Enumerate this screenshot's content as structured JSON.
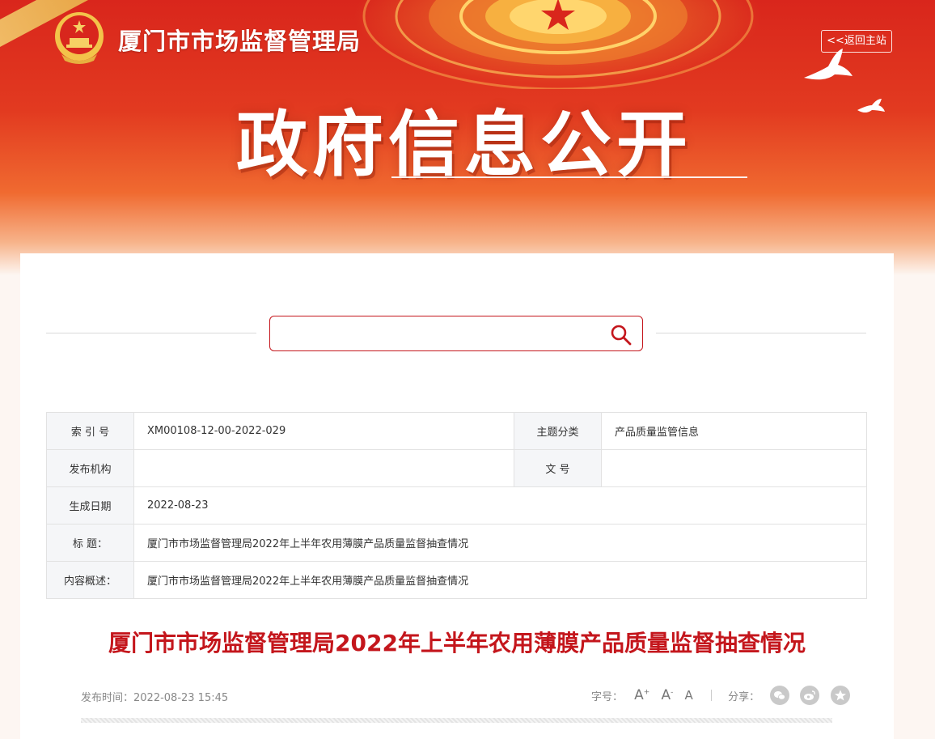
{
  "header": {
    "site_title": "厦门市市场监督管理局",
    "banner_title": "政府信息公开",
    "back_link": "<<返回主站"
  },
  "search": {
    "placeholder": ""
  },
  "meta": {
    "index_no_label": "索 引 号",
    "index_no": "XM00108-12-00-2022-029",
    "topic_label": "主题分类",
    "topic": "产品质量监管信息",
    "publisher_label": "发布机构",
    "publisher": "",
    "doc_no_label": "文  号",
    "doc_no": "",
    "date_label": "生成日期",
    "date": "2022-08-23",
    "title_label": "标  题：",
    "title": "厦门市市场监督管理局2022年上半年农用薄膜产品质量监督抽查情况",
    "summary_label": "内容概述：",
    "summary": "厦门市市场监督管理局2022年上半年农用薄膜产品质量监督抽查情况"
  },
  "article": {
    "title": "厦门市市场监督管理局2022年上半年农用薄膜产品质量监督抽查情况",
    "publish_time": "发布时间：2022-08-23 15:45",
    "font_size_label": "字号：",
    "font_large": "A",
    "font_medium": "A",
    "font_small": "A",
    "share_label": "分享："
  },
  "icons": {
    "search": "search-icon",
    "wechat": "wechat-icon",
    "weibo": "weibo-icon",
    "favorite": "star-icon"
  },
  "colors": {
    "accent": "#c4161c",
    "banner": "#e23a20"
  }
}
